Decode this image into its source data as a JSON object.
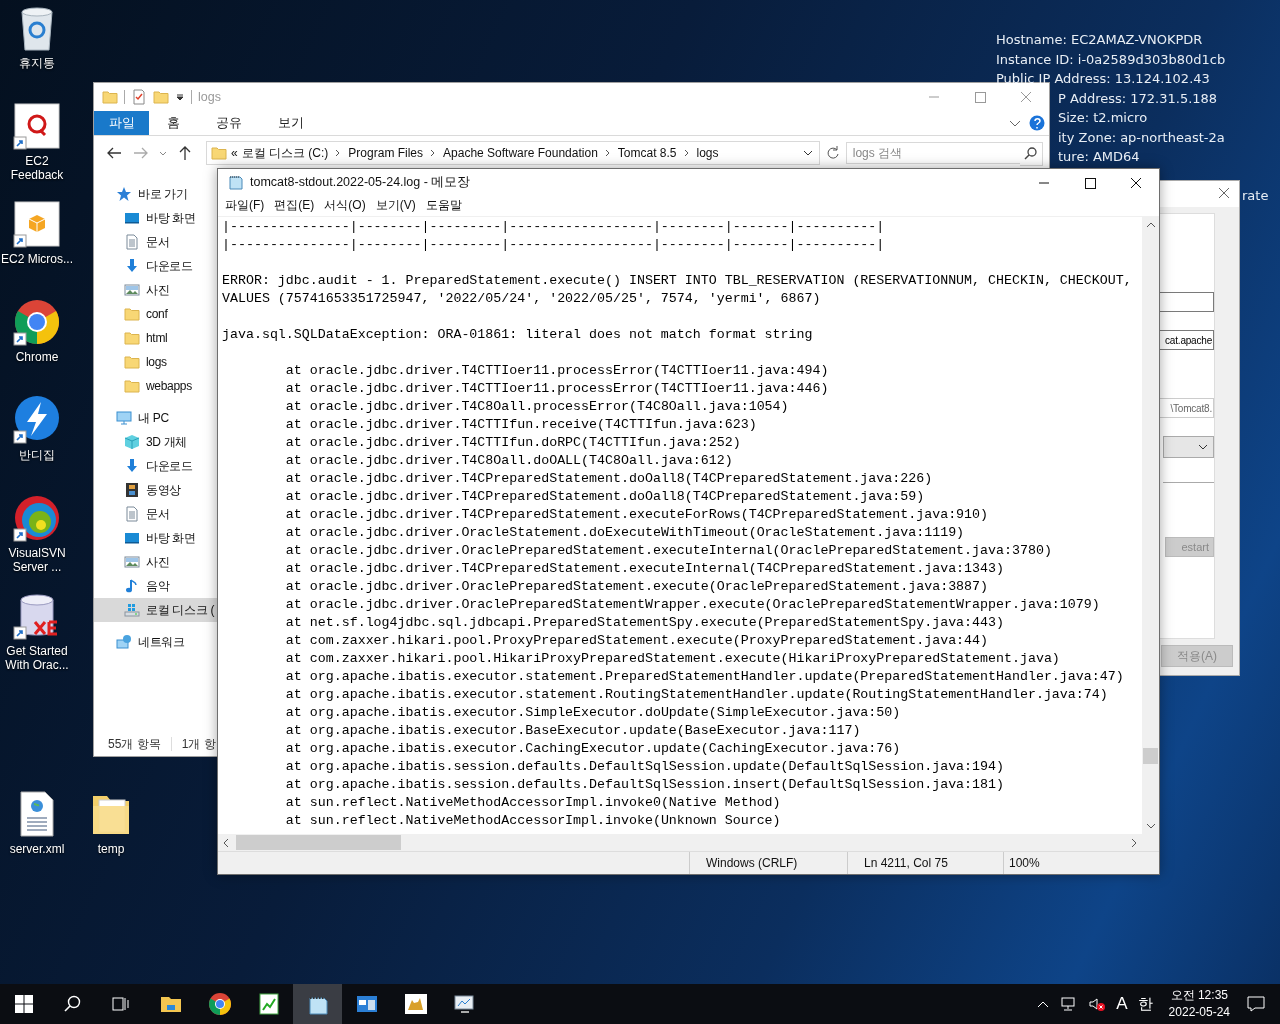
{
  "desktop_icons": [
    {
      "label": "휴지통",
      "kind": "recycle",
      "shortcut": false
    },
    {
      "label": "EC2 Feedback",
      "kind": "feedback",
      "shortcut": true
    },
    {
      "label": "EC2 Micros...",
      "kind": "ec2",
      "shortcut": true
    },
    {
      "label": "Chrome",
      "kind": "chrome",
      "shortcut": true
    },
    {
      "label": "반디집",
      "kind": "bandizip",
      "shortcut": true
    },
    {
      "label": "VisualSVN Server ...",
      "kind": "svn",
      "shortcut": true
    },
    {
      "label": "Get Started With Orac...",
      "kind": "oracle",
      "shortcut": true
    }
  ],
  "desktop_files": [
    {
      "label": "server.xml",
      "kind": "xml"
    },
    {
      "label": "temp",
      "kind": "folder"
    }
  ],
  "system_info": {
    "lines": [
      "Hostname: EC2AMAZ-VNOKPDR",
      "Instance ID: i-0a2589d303b80d1cb",
      "Public IP Address: 13.124.102.43"
    ],
    "lines_beside_explorer": [
      "P Address: 172.31.5.188",
      "Size: t2.micro",
      "ity Zone: ap-northeast-2a",
      "ture: AMD64"
    ],
    "text_beside_dialog": "rate"
  },
  "explorer": {
    "title": "logs",
    "ribbon_tabs": [
      {
        "label": "파일",
        "selected": true
      },
      {
        "label": "홈",
        "selected": false
      },
      {
        "label": "공유",
        "selected": false
      },
      {
        "label": "보기",
        "selected": false
      }
    ],
    "path_overflow": "«",
    "path": [
      "로컬 디스크 (C:)",
      "Program Files",
      "Apache Software Foundation",
      "Tomcat 8.5",
      "logs"
    ],
    "search": {
      "placeholder": "logs 검색"
    },
    "nav": [
      {
        "label": "바로 가기",
        "kind": "star",
        "selected": false,
        "children": [
          {
            "label": "바탕 화면",
            "kind": "desktop",
            "selected": false
          },
          {
            "label": "문서",
            "kind": "documents",
            "selected": false
          },
          {
            "label": "다운로드",
            "kind": "download",
            "selected": false
          },
          {
            "label": "사진",
            "kind": "pictures",
            "selected": false
          },
          {
            "label": "conf",
            "kind": "folder",
            "selected": false
          },
          {
            "label": "html",
            "kind": "folder",
            "selected": false
          },
          {
            "label": "logs",
            "kind": "folder",
            "selected": false
          },
          {
            "label": "webapps",
            "kind": "folder",
            "selected": false
          }
        ]
      },
      {
        "label": "내 PC",
        "kind": "pc",
        "selected": false,
        "children": [
          {
            "label": "3D 개체",
            "kind": "cube",
            "selected": false
          },
          {
            "label": "다운로드",
            "kind": "download",
            "selected": false
          },
          {
            "label": "동영상",
            "kind": "video",
            "selected": false
          },
          {
            "label": "문서",
            "kind": "documents",
            "selected": false
          },
          {
            "label": "바탕 화면",
            "kind": "desktop",
            "selected": false
          },
          {
            "label": "사진",
            "kind": "pictures",
            "selected": false
          },
          {
            "label": "음악",
            "kind": "music",
            "selected": false
          },
          {
            "label": "로컬 디스크 (",
            "kind": "drive",
            "selected": true
          }
        ]
      },
      {
        "label": "네트워크",
        "kind": "network",
        "selected": false
      }
    ],
    "status": [
      "55개 항목",
      "1개 항"
    ]
  },
  "notepad": {
    "title": "tomcat8-stdout.2022-05-24.log - 메모장",
    "menu": [
      "파일(F)",
      "편집(E)",
      "서식(O)",
      "보기(V)",
      "도움말"
    ],
    "lines": [
      {
        "kind": "text",
        "text": "|---------------|--------|---------|------------------|--------|-------|----------|"
      },
      {
        "kind": "text",
        "text": "|---------------|--------|---------|------------------|--------|-------|----------|"
      },
      {
        "kind": "blank"
      },
      {
        "kind": "text",
        "text": "ERROR: jdbc.audit - 1. PreparedStatement.execute() INSERT INTO TBL_RESERVATION (RESERVATIONNUM, CHECKIN, CHECKOUT,"
      },
      {
        "kind": "text",
        "text": "VALUES (75741653351725947, '2022/05/24', '2022/05/25', 7574, 'yermi', 6867)"
      },
      {
        "kind": "blank"
      },
      {
        "kind": "text",
        "text": "java.sql.SQLDataException: ORA-01861: literal does not match format string"
      },
      {
        "kind": "blank"
      },
      {
        "kind": "text",
        "text": "\tat oracle.jdbc.driver.T4CTTIoer11.processError(T4CTTIoer11.java:494)"
      },
      {
        "kind": "text",
        "text": "\tat oracle.jdbc.driver.T4CTTIoer11.processError(T4CTTIoer11.java:446)"
      },
      {
        "kind": "text",
        "text": "\tat oracle.jdbc.driver.T4C8Oall.processError(T4C8Oall.java:1054)"
      },
      {
        "kind": "text",
        "text": "\tat oracle.jdbc.driver.T4CTTIfun.receive(T4CTTIfun.java:623)"
      },
      {
        "kind": "text",
        "text": "\tat oracle.jdbc.driver.T4CTTIfun.doRPC(T4CTTIfun.java:252)"
      },
      {
        "kind": "text",
        "text": "\tat oracle.jdbc.driver.T4C8Oall.doOALL(T4C8Oall.java:612)"
      },
      {
        "kind": "text",
        "text": "\tat oracle.jdbc.driver.T4CPreparedStatement.doOall8(T4CPreparedStatement.java:226)"
      },
      {
        "kind": "text",
        "text": "\tat oracle.jdbc.driver.T4CPreparedStatement.doOall8(T4CPreparedStatement.java:59)"
      },
      {
        "kind": "text",
        "text": "\tat oracle.jdbc.driver.T4CPreparedStatement.executeForRows(T4CPreparedStatement.java:910)"
      },
      {
        "kind": "text",
        "text": "\tat oracle.jdbc.driver.OracleStatement.doExecuteWithTimeout(OracleStatement.java:1119)"
      },
      {
        "kind": "text",
        "text": "\tat oracle.jdbc.driver.OraclePreparedStatement.executeInternal(OraclePreparedStatement.java:3780)"
      },
      {
        "kind": "text",
        "text": "\tat oracle.jdbc.driver.T4CPreparedStatement.executeInternal(T4CPreparedStatement.java:1343)"
      },
      {
        "kind": "text",
        "text": "\tat oracle.jdbc.driver.OraclePreparedStatement.execute(OraclePreparedStatement.java:3887)"
      },
      {
        "kind": "text",
        "text": "\tat oracle.jdbc.driver.OraclePreparedStatementWrapper.execute(OraclePreparedStatementWrapper.java:1079)"
      },
      {
        "kind": "text",
        "text": "\tat net.sf.log4jdbc.sql.jdbcapi.PreparedStatementSpy.execute(PreparedStatementSpy.java:443)"
      },
      {
        "kind": "text",
        "text": "\tat com.zaxxer.hikari.pool.ProxyPreparedStatement.execute(ProxyPreparedStatement.java:44)"
      },
      {
        "kind": "text",
        "text": "\tat com.zaxxer.hikari.pool.HikariProxyPreparedStatement.execute(HikariProxyPreparedStatement.java)"
      },
      {
        "kind": "text",
        "text": "\tat org.apache.ibatis.executor.statement.PreparedStatementHandler.update(PreparedStatementHandler.java:47)"
      },
      {
        "kind": "text",
        "text": "\tat org.apache.ibatis.executor.statement.RoutingStatementHandler.update(RoutingStatementHandler.java:74)"
      },
      {
        "kind": "text",
        "text": "\tat org.apache.ibatis.executor.SimpleExecutor.doUpdate(SimpleExecutor.java:50)"
      },
      {
        "kind": "text",
        "text": "\tat org.apache.ibatis.executor.BaseExecutor.update(BaseExecutor.java:117)"
      },
      {
        "kind": "text",
        "text": "\tat org.apache.ibatis.executor.CachingExecutor.update(CachingExecutor.java:76)"
      },
      {
        "kind": "text",
        "text": "\tat org.apache.ibatis.session.defaults.DefaultSqlSession.update(DefaultSqlSession.java:194)"
      },
      {
        "kind": "text",
        "text": "\tat org.apache.ibatis.session.defaults.DefaultSqlSession.insert(DefaultSqlSession.java:181)"
      },
      {
        "kind": "text",
        "text": "\tat sun.reflect.NativeMethodAccessorImpl.invoke0(Native Method)"
      },
      {
        "kind": "text",
        "text": "\tat sun.reflect.NativeMethodAccessorImpl.invoke(Unknown Source)"
      }
    ],
    "status": [
      "Windows (CRLF)",
      "Ln 4211, Col 75",
      "100%"
    ]
  },
  "service_dialog": {
    "controls": [
      {
        "kind": "input"
      },
      {
        "kind": "input",
        "value": "cat.apache"
      },
      {
        "kind": "readonly",
        "value": "\\Tomcat8."
      },
      {
        "kind": "select"
      },
      {
        "kind": "divider"
      },
      {
        "kind": "button",
        "label": "estart",
        "disabled": true
      }
    ],
    "apply_button": {
      "label": "적용(A)",
      "disabled": true
    }
  },
  "taskbar": {
    "apps": [
      {
        "kind": "explorer",
        "active": false
      },
      {
        "kind": "chrome",
        "active": false
      },
      {
        "kind": "chart",
        "active": false
      },
      {
        "kind": "notepad",
        "active": true
      },
      {
        "kind": "window",
        "active": false
      },
      {
        "kind": "tomcat",
        "active": false
      },
      {
        "kind": "monitor",
        "active": false
      }
    ],
    "ime_mode": "A",
    "ime_lang": "한",
    "time": "오전 12:35",
    "date": "2022-05-24"
  }
}
